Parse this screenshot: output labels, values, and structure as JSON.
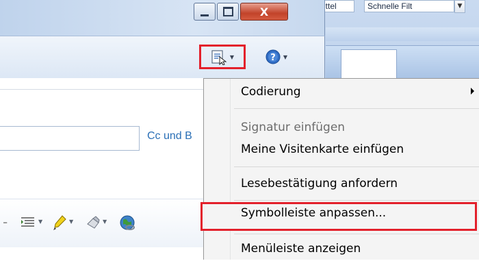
{
  "background_window": {
    "field_1": "ittel",
    "field_2": "Schnelle Filt",
    "dropdown_icon": "chevron-down-icon"
  },
  "window": {
    "buttons": {
      "minimize": "minimize-icon",
      "maximize": "maximize-icon",
      "close": "X"
    },
    "toolbar": {
      "tools_icon": "document-cursor-icon",
      "help_icon": "help-circle-icon"
    },
    "cc_link": "Cc und B",
    "format_toolbar": {
      "icons": [
        "dash",
        "indent-list-icon",
        "highlighter-pen-icon",
        "stamp-icon",
        "globe-link-icon"
      ]
    }
  },
  "context_menu": {
    "items": [
      {
        "label": "Codierung",
        "submenu": true
      },
      {
        "label": "Signatur einfügen",
        "disabled": true
      },
      {
        "label": "Meine Visitenkarte einfügen"
      },
      {
        "label": "Lesebestätigung anfordern"
      },
      {
        "label": "Symbolleiste anpassen...",
        "highlighted": true
      },
      {
        "label": "Menüleiste anzeigen"
      }
    ]
  },
  "colors": {
    "highlight_border": "#e3202b",
    "link": "#2a6fb6",
    "menu_background": "#f4f4f4"
  }
}
